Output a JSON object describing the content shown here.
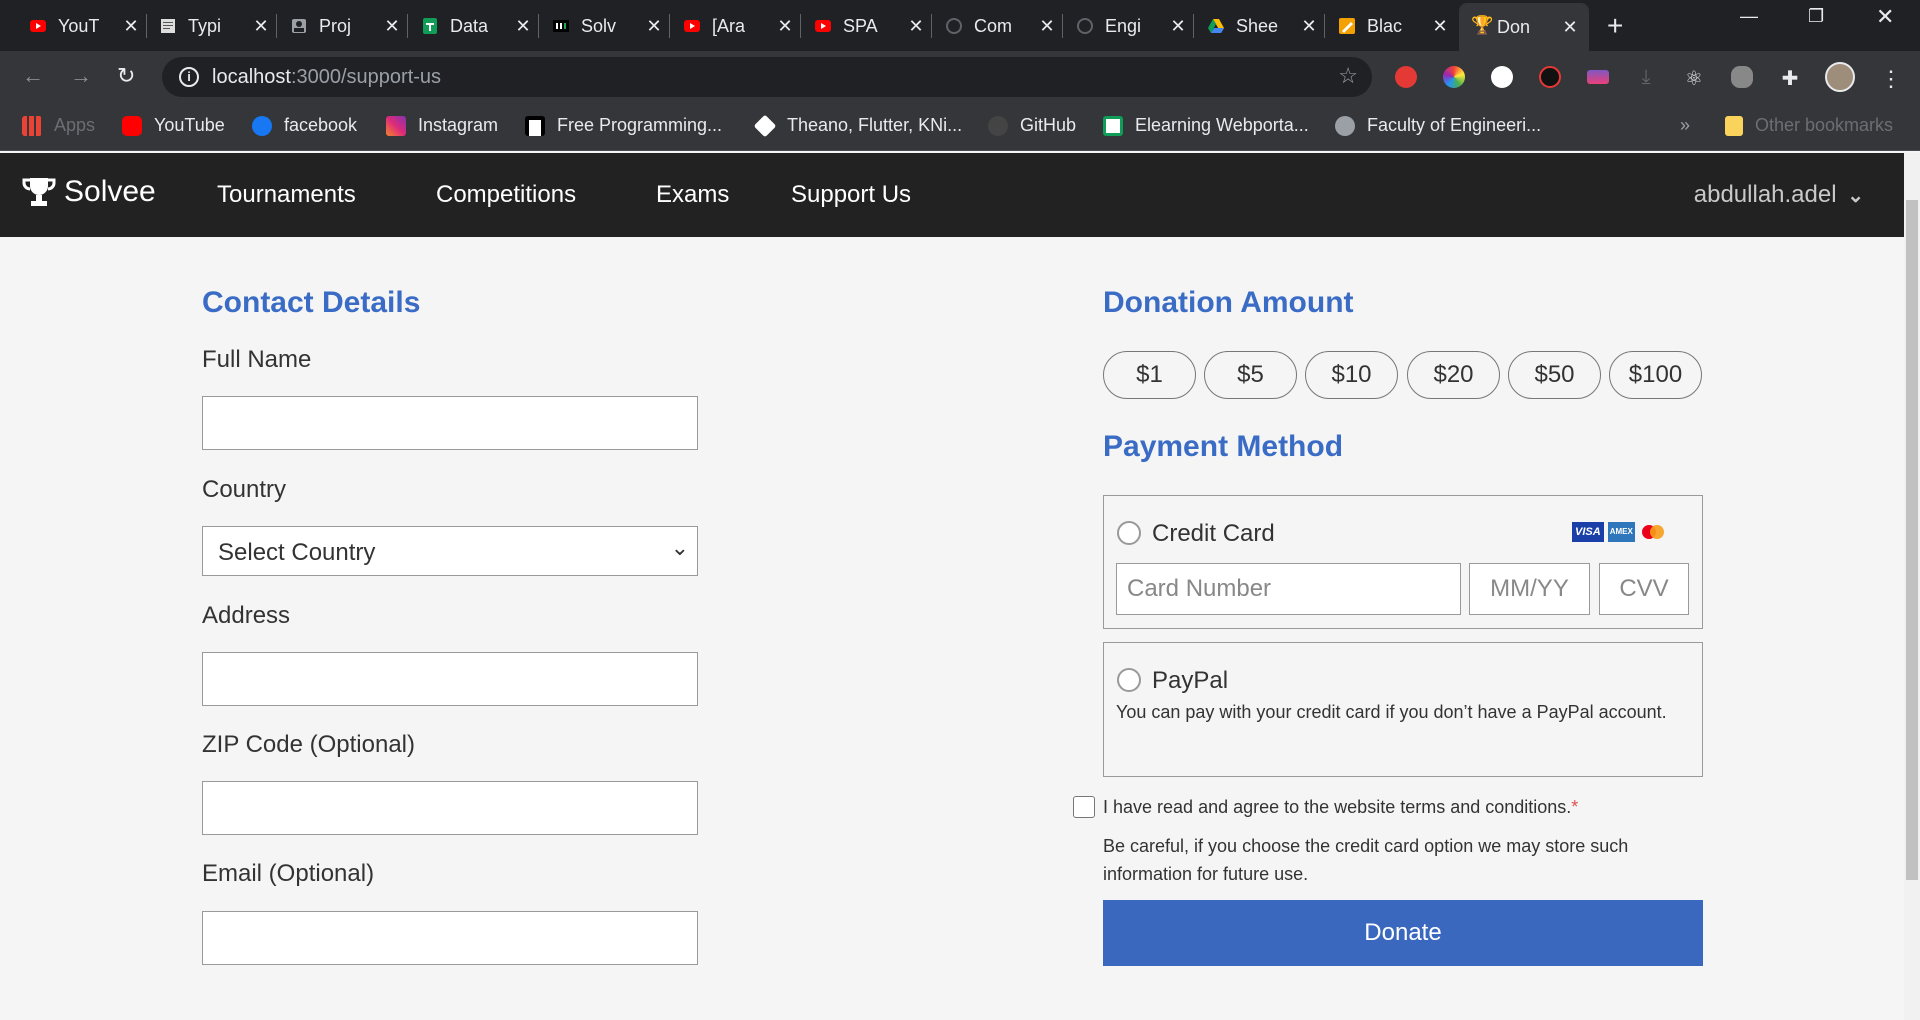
{
  "tabs": [
    {
      "label": "YouT",
      "icon": "youtube-icon"
    },
    {
      "label": "Typi",
      "icon": "page-icon"
    },
    {
      "label": "Proj",
      "icon": "account-icon"
    },
    {
      "label": "Data",
      "icon": "sheets-icon"
    },
    {
      "label": "Solv",
      "icon": "hackerrank-icon"
    },
    {
      "label": "[Ara",
      "icon": "youtube-icon"
    },
    {
      "label": "SPA",
      "icon": "youtube-icon"
    },
    {
      "label": "Com",
      "icon": "github-icon"
    },
    {
      "label": "Engi",
      "icon": "github-icon"
    },
    {
      "label": "Shee",
      "icon": "drive-icon"
    },
    {
      "label": "Blac",
      "icon": "notes-icon"
    },
    {
      "label": "Don",
      "icon": "trophy-icon"
    }
  ],
  "address_bar": {
    "host": "localhost",
    "path": ":3000/support-us"
  },
  "bookmarks": [
    {
      "label": "Apps"
    },
    {
      "label": "YouTube"
    },
    {
      "label": "facebook"
    },
    {
      "label": "Instagram"
    },
    {
      "label": "Free Programming..."
    },
    {
      "label": "Theano, Flutter, KNi..."
    },
    {
      "label": "GitHub"
    },
    {
      "label": "Elearning Webporta..."
    },
    {
      "label": "Faculty of Engineeri..."
    },
    {
      "label": "»"
    },
    {
      "label": "Other bookmarks"
    }
  ],
  "nav": {
    "brand": "Solvee",
    "links": [
      "Tournaments",
      "Competitions",
      "Exams",
      "Support Us"
    ],
    "user": "abdullah.adel"
  },
  "contact": {
    "title": "Contact Details",
    "full_name_label": "Full Name",
    "country_label": "Country",
    "country_value": "Select Country",
    "address_label": "Address",
    "zip_label": "ZIP Code (Optional)",
    "email_label": "Email (Optional)"
  },
  "donation": {
    "title": "Donation Amount",
    "amounts": [
      "$1",
      "$5",
      "$10",
      "$20",
      "$50",
      "$100"
    ]
  },
  "payment": {
    "title": "Payment Method",
    "credit_card_label": "Credit Card",
    "card_number_placeholder": "Card Number",
    "expiry_placeholder": "MM/YY",
    "cvv_placeholder": "CVV",
    "paypal_label": "PayPal",
    "paypal_note": "You can pay with your credit card if you don’t have a PayPal account.",
    "card_brands": [
      "VISA",
      "AMEX",
      "mastercard"
    ]
  },
  "terms": {
    "text": "I have read and agree to the website terms and conditions.",
    "required_mark": "*",
    "warning": "Be careful, if you choose the credit card option we may store such information for future use."
  },
  "donate_button": "Donate",
  "colors": {
    "accent": "#3a6cc6",
    "nav_bg": "#222222",
    "button": "#3a68bf"
  }
}
